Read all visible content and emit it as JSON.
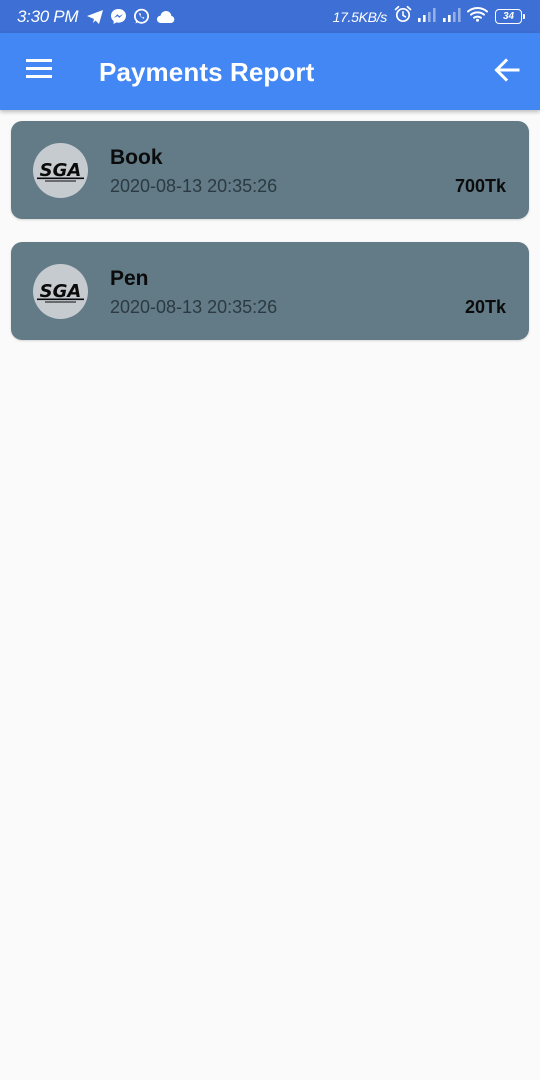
{
  "status_bar": {
    "time": "3:30 PM",
    "net_speed": "17.5KB/s",
    "battery_level": "34",
    "icons": [
      "telegram-icon",
      "messenger-icon",
      "whatsapp-icon",
      "cloud-icon",
      "alarm-icon",
      "signal-icon",
      "signal-icon",
      "wifi-icon",
      "battery-icon"
    ]
  },
  "app_bar": {
    "title": "Payments Report",
    "menu_icon": "menu-icon",
    "back_icon": "arrow-back-icon",
    "background_color": "#4387f4"
  },
  "payments": [
    {
      "name": "Book",
      "date": "2020-08-13 20:35:26",
      "amount": "700Tk",
      "logo_text": "SGA"
    },
    {
      "name": "Pen",
      "date": "2020-08-13 20:35:26",
      "amount": "20Tk",
      "logo_text": "SGA"
    }
  ],
  "colors": {
    "status_bar": "#3d6fd4",
    "card": "#627b87",
    "page_background": "#fafafa"
  }
}
